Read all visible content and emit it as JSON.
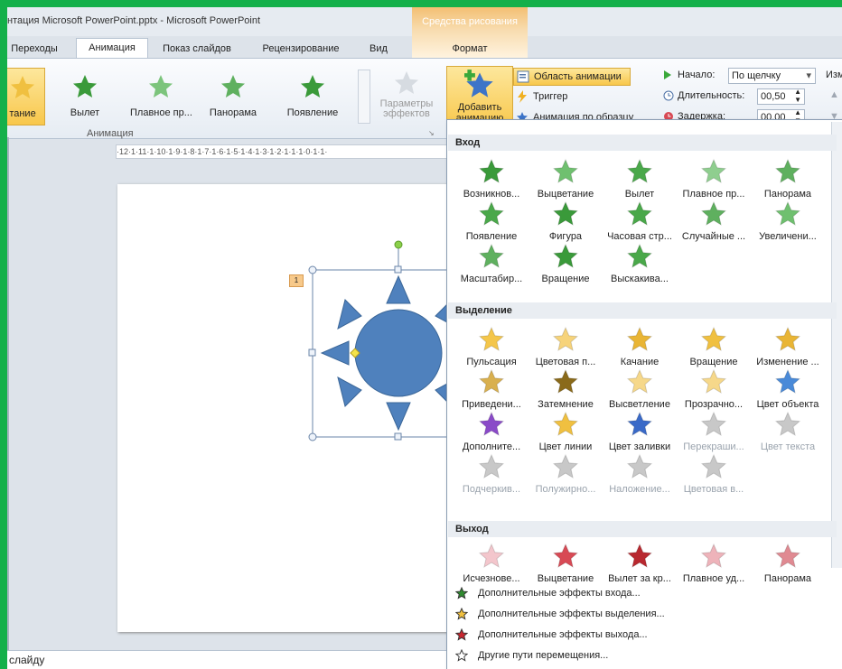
{
  "window": {
    "title": "нтация Microsoft PowerPoint.pptx  -  Microsoft PowerPoint",
    "context_group": "Средства рисования"
  },
  "tabs": [
    "Переходы",
    "Анимация",
    "Показ слайдов",
    "Рецензирование",
    "Вид",
    "Формат"
  ],
  "ribbon": {
    "gallery": [
      "тание",
      "Вылет",
      "Плавное пр...",
      "Панорама",
      "Появление"
    ],
    "params_label": "Параметры эффектов",
    "add_label": "Добавить анимацию",
    "animation_pane": "Область анимации",
    "trigger": "Триггер",
    "painter": "Анимация по образцу",
    "start_label": "Начало:",
    "start_value": "По щелчку",
    "duration_label": "Длительность:",
    "duration_value": "00,50",
    "delay_label": "Задержка:",
    "delay_value": "00,00",
    "group_label": "Анимация",
    "cut_label": "Изм"
  },
  "ruler_text": "·12·1·11·1·10·1·9·1·8·1·7·1·6·1·5·1·4·1·3·1·2·1·1·1·0·1·1·",
  "slide": {
    "anim_badge": "1"
  },
  "notes_text": "слайду",
  "menu": {
    "sections": [
      {
        "title": "Вход",
        "items": [
          {
            "label": "Возникнов...",
            "color": "#3a9a3a"
          },
          {
            "label": "Выцветание",
            "color": "#6fc06f"
          },
          {
            "label": "Вылет",
            "color": "#4aa84a"
          },
          {
            "label": "Плавное пр...",
            "color": "#8fce8f"
          },
          {
            "label": "Панорама",
            "color": "#5fb05f"
          },
          {
            "label": "Появление",
            "color": "#4aa84a"
          },
          {
            "label": "Фигура",
            "color": "#3a9a3a"
          },
          {
            "label": "Часовая стр...",
            "color": "#4aa84a"
          },
          {
            "label": "Случайные ...",
            "color": "#5fb05f"
          },
          {
            "label": "Увеличени...",
            "color": "#6fc06f"
          },
          {
            "label": "Масштабир...",
            "color": "#5fb05f"
          },
          {
            "label": "Вращение",
            "color": "#3a9a3a"
          },
          {
            "label": "Выскакива...",
            "color": "#4aa84a"
          }
        ]
      },
      {
        "title": "Выделение",
        "items": [
          {
            "label": "Пульсация",
            "color": "#f4c64a"
          },
          {
            "label": "Цветовая п...",
            "color": "#f6d37a"
          },
          {
            "label": "Качание",
            "color": "#e9b535"
          },
          {
            "label": "Вращение",
            "color": "#f0c040"
          },
          {
            "label": "Изменение ...",
            "color": "#e9b535"
          },
          {
            "label": "Приведени...",
            "color": "#d9b04f"
          },
          {
            "label": "Затемнение",
            "color": "#8a6a1a"
          },
          {
            "label": "Высветление",
            "color": "#f6d88a"
          },
          {
            "label": "Прозрачно...",
            "color": "#f6d88a"
          },
          {
            "label": "Цвет объекта",
            "color": "#4a8ad8"
          },
          {
            "label": "Дополните...",
            "color": "#8a4ac8"
          },
          {
            "label": "Цвет линии",
            "color": "#f0c040"
          },
          {
            "label": "Цвет заливки",
            "color": "#3a6ac8"
          },
          {
            "label": "Перекраши...",
            "color": "#c8c8c8"
          },
          {
            "label": "Цвет текста",
            "color": "#c8c8c8"
          },
          {
            "label": "Подчеркив...",
            "color": "#c8c8c8"
          },
          {
            "label": "Полужирно...",
            "color": "#c8c8c8"
          },
          {
            "label": "Наложение...",
            "color": "#c8c8c8"
          },
          {
            "label": "Цветовая в...",
            "color": "#c8c8c8"
          }
        ]
      },
      {
        "title": "Выход",
        "items": [
          {
            "label": "Исчезнове...",
            "color": "#f3c6cc"
          },
          {
            "label": "Выцветание",
            "color": "#d84a55"
          },
          {
            "label": "Вылет за кр...",
            "color": "#b8282f"
          },
          {
            "label": "Плавное уд...",
            "color": "#eeb3ba"
          },
          {
            "label": "Панорама",
            "color": "#e08a92"
          }
        ]
      }
    ],
    "more": [
      "Дополнительные эффекты входа...",
      "Дополнительные эффекты выделения...",
      "Дополнительные эффекты выхода...",
      "Другие пути перемещения..."
    ]
  },
  "colors": {
    "shape_fill": "#4f81bd",
    "selection": "#f8c74b"
  }
}
